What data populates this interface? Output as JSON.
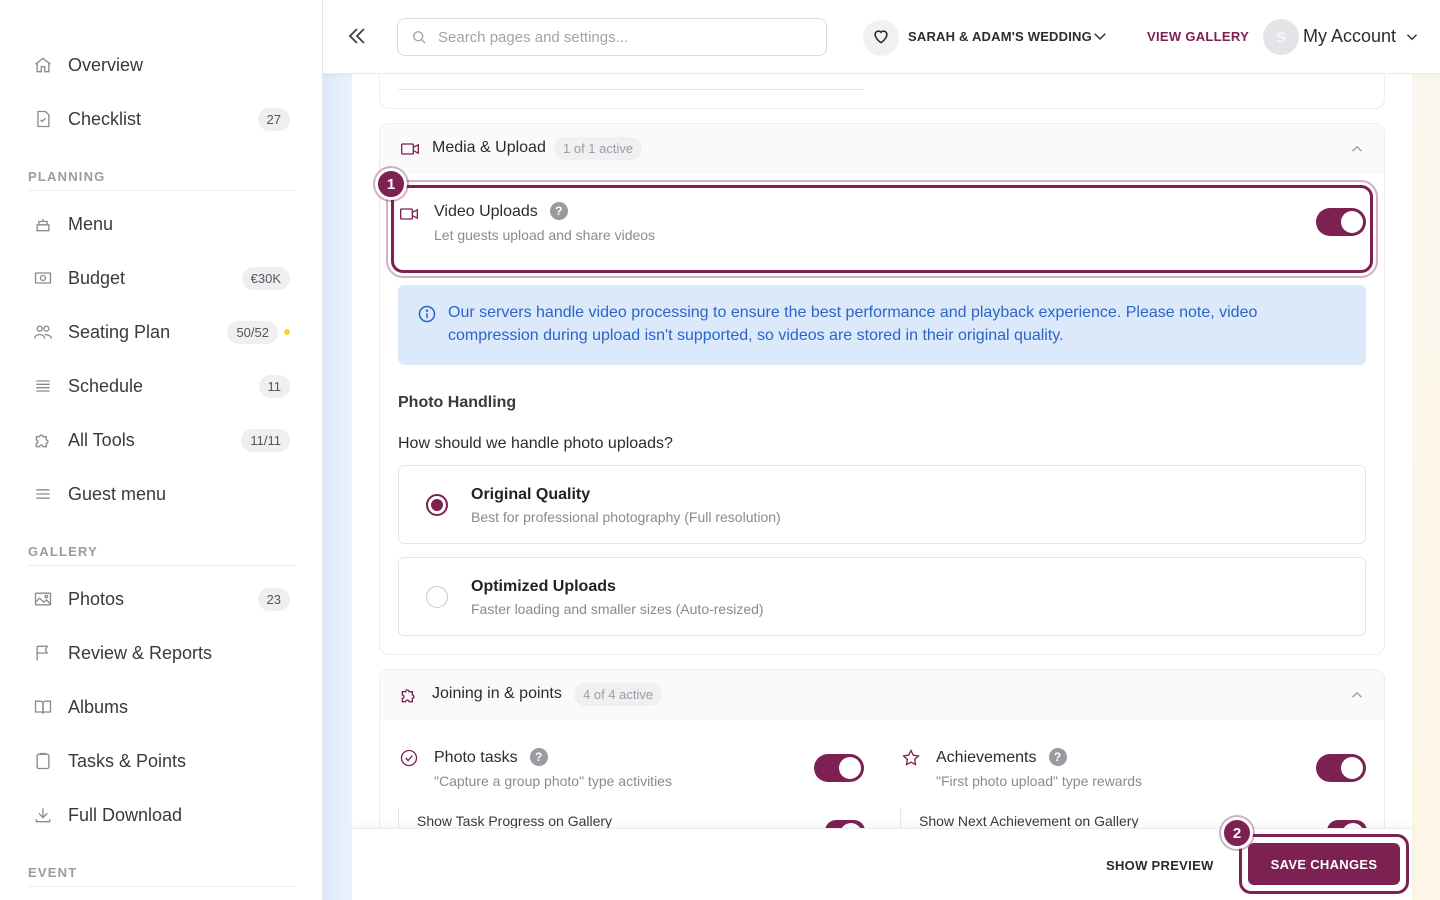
{
  "sidebar": {
    "items": [
      {
        "label": "Overview",
        "badge": ""
      },
      {
        "label": "Checklist",
        "badge": "27"
      }
    ],
    "planning_heading": "PLANNING",
    "planning": [
      {
        "label": "Menu",
        "badge": ""
      },
      {
        "label": "Budget",
        "badge": "€30K"
      },
      {
        "label": "Seating Plan",
        "badge": "50/52"
      },
      {
        "label": "Schedule",
        "badge": "11"
      },
      {
        "label": "All Tools",
        "badge": "11/11"
      },
      {
        "label": "Guest menu",
        "badge": ""
      }
    ],
    "gallery_heading": "GALLERY",
    "gallery": [
      {
        "label": "Photos",
        "badge": "23"
      },
      {
        "label": "Review & Reports",
        "badge": ""
      },
      {
        "label": "Albums",
        "badge": ""
      },
      {
        "label": "Tasks & Points",
        "badge": ""
      },
      {
        "label": "Full Download",
        "badge": ""
      }
    ],
    "event_heading": "EVENT"
  },
  "topbar": {
    "search_placeholder": "Search pages and settings...",
    "event_name": "SARAH & ADAM'S WEDDING",
    "view_gallery": "VIEW GALLERY",
    "avatar_initial": "S",
    "account_label": "My Account"
  },
  "media_upload": {
    "title": "Media & Upload",
    "status": "1 of 1 active",
    "video_uploads": {
      "title": "Video Uploads",
      "subtitle": "Let guests upload and share videos",
      "help": "?",
      "enabled": true
    },
    "info": "Our servers handle video processing to ensure the best performance and playback experience. Please note, video compression during upload isn't supported, so videos are stored in their original quality.",
    "photo_handling_heading": "Photo Handling",
    "photo_handling_question": "How should we handle photo uploads?",
    "options": [
      {
        "title": "Original Quality",
        "subtitle": "Best for professional photography (Full resolution)",
        "selected": true
      },
      {
        "title": "Optimized Uploads",
        "subtitle": "Faster loading and smaller sizes (Auto-resized)",
        "selected": false
      }
    ]
  },
  "joining": {
    "title": "Joining in & points",
    "status": "4 of 4 active",
    "photo_tasks": {
      "title": "Photo tasks",
      "subtitle": "\"Capture a group photo\" type activities",
      "help": "?",
      "enabled": true
    },
    "achievements": {
      "title": "Achievements",
      "subtitle": "\"First photo upload\" type rewards",
      "help": "?",
      "enabled": true
    },
    "show_task_progress": "Show Task Progress on Gallery",
    "show_next_achievement": "Show Next Achievement on Gallery"
  },
  "annotations": {
    "step1": "1",
    "step2": "2"
  },
  "actions": {
    "show_preview": "SHOW PREVIEW",
    "save_changes": "SAVE CHANGES"
  },
  "colors": {
    "accent": "#7c2151",
    "info_bg": "#dbe9fb",
    "info_text": "#2d64c8"
  }
}
